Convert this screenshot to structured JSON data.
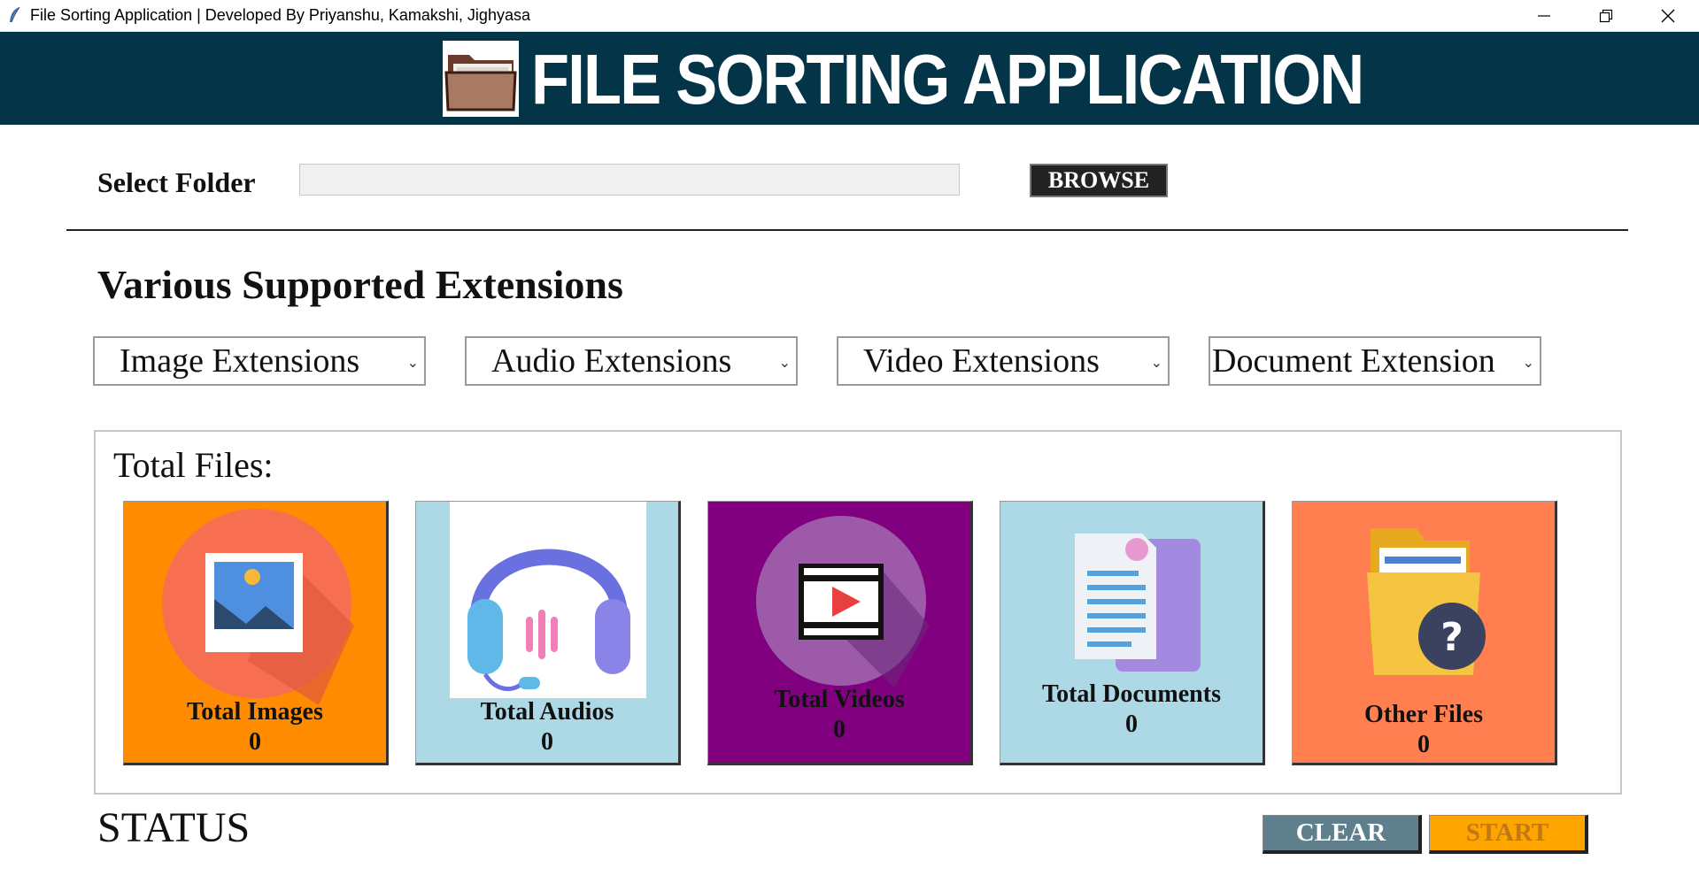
{
  "window": {
    "title": "File Sorting Application | Developed By Priyanshu, Kamakshi, Jighyasa",
    "icon": "feather-icon",
    "controls": [
      "minimize-icon",
      "restore-icon",
      "close-icon"
    ]
  },
  "banner": {
    "title": "FILE SORTING APPLICATION",
    "background": "#033448",
    "logo_icon": "folder-icon"
  },
  "select_folder": {
    "label": "Select Folder",
    "value": "",
    "browse_label": "BROWSE"
  },
  "extensions": {
    "heading": "Various Supported Extensions",
    "dropdowns": [
      {
        "label": "Image Extensions"
      },
      {
        "label": "Audio Extensions"
      },
      {
        "label": "Video Extensions"
      },
      {
        "label": "Document Extension"
      }
    ]
  },
  "totals": {
    "title": "Total Files:",
    "cards": [
      {
        "label": "Total Images",
        "count": "0",
        "color": "#ff8c00",
        "icon": "image-icon"
      },
      {
        "label": "Total Audios",
        "count": "0",
        "color": "#add8e6",
        "icon": "headphones-icon"
      },
      {
        "label": "Total Videos",
        "count": "0",
        "color": "#800080",
        "icon": "video-icon"
      },
      {
        "label": "Total Documents",
        "count": "0",
        "color": "#add8e6",
        "icon": "document-icon"
      },
      {
        "label": "Other Files",
        "count": "0",
        "color": "#ff7f50",
        "icon": "folder-question-icon"
      }
    ]
  },
  "status": {
    "label": "STATUS"
  },
  "actions": {
    "clear_label": "CLEAR",
    "clear_color": "#5f7f8c",
    "start_label": "START",
    "start_color": "#ffa500"
  }
}
